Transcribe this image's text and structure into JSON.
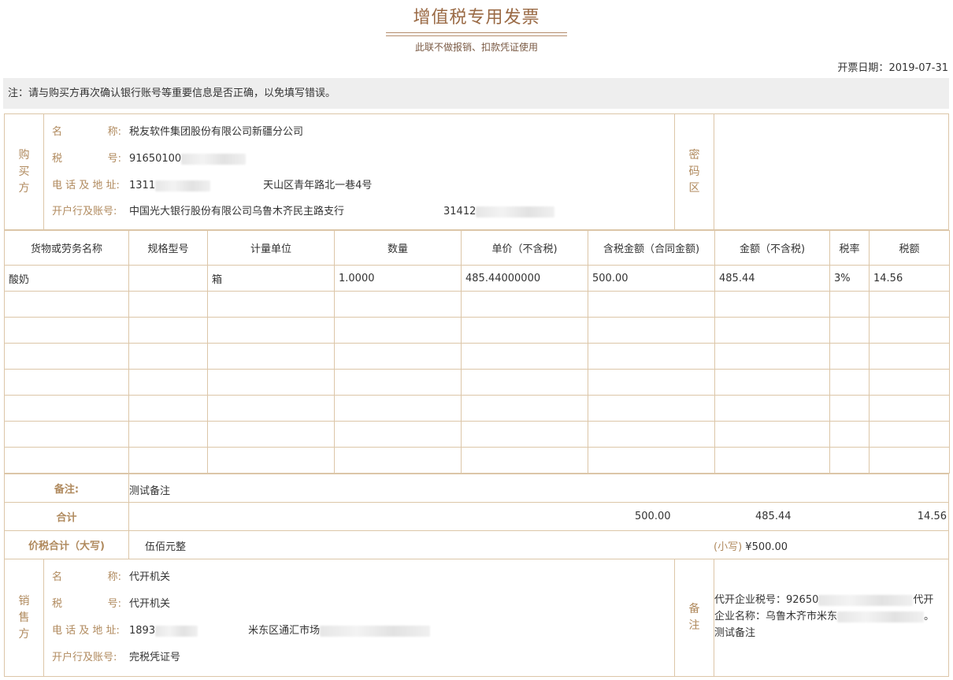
{
  "header": {
    "title": "增值税专用发票",
    "subtitle": "此联不做报销、扣款凭证使用",
    "date_label": "开票日期：",
    "date_value": "2019-07-31"
  },
  "notice": "注：请与购买方再次确认银行账号等重要信息是否正确，以免填写错误。",
  "buyer": {
    "side": "购买方",
    "name_label_a": "名",
    "name_label_b": "称:",
    "name": "税友软件集团股份有限公司新疆分公司",
    "tax_label_a": "税",
    "tax_label_b": "号:",
    "tax_id": "91650100",
    "contact_label": "电 话 及 地 址:",
    "phone": "1311",
    "address": "天山区青年路北一巷4号",
    "bank_label": "开户行及账号:",
    "bank": "中国光大银行股份有限公司乌鲁木齐民主路支行",
    "account": "31412"
  },
  "cipher": {
    "side": "密码区"
  },
  "items_table": {
    "headers": [
      "货物或劳务名称",
      "规格型号",
      "计量单位",
      "数量",
      "单价（不含税)",
      "含税金额（合同金额)",
      "金额（不含税)",
      "税率",
      "税额"
    ],
    "rows": [
      [
        "酸奶",
        "",
        "箱",
        "1.0000",
        "485.44000000",
        "500.00",
        "485.44",
        "3%",
        "14.56"
      ],
      [
        "",
        "",
        "",
        "",
        "",
        "",
        "",
        "",
        ""
      ],
      [
        "",
        "",
        "",
        "",
        "",
        "",
        "",
        "",
        ""
      ],
      [
        "",
        "",
        "",
        "",
        "",
        "",
        "",
        "",
        ""
      ],
      [
        "",
        "",
        "",
        "",
        "",
        "",
        "",
        "",
        ""
      ],
      [
        "",
        "",
        "",
        "",
        "",
        "",
        "",
        "",
        ""
      ],
      [
        "",
        "",
        "",
        "",
        "",
        "",
        "",
        "",
        ""
      ],
      [
        "",
        "",
        "",
        "",
        "",
        "",
        "",
        "",
        ""
      ]
    ]
  },
  "remarks": {
    "label": "备注:",
    "value": "测试备注"
  },
  "totals": {
    "label": "合计",
    "amount_with_tax": "500.00",
    "amount": "485.44",
    "tax": "14.56"
  },
  "grand_total": {
    "label": "价税合计（大写)",
    "words": "伍佰元整",
    "small_label": "(小写)",
    "small_value": "¥500.00"
  },
  "seller": {
    "side": "销售方",
    "name_label_a": "名",
    "name_label_b": "称:",
    "name": "代开机关",
    "tax_label_a": "税",
    "tax_label_b": "号:",
    "tax_id": "代开机关",
    "contact_label": "电 话 及 地 址:",
    "phone": "1893",
    "address": "米东区通汇市场",
    "bank_label": "开户行及账号:",
    "bank": "完税凭证号",
    "remark_side": "备注",
    "remark_line1": "代开企业税号：92650",
    "remark_line1_tail": "代开",
    "remark_line2": "企业名称：乌鲁木齐市米东",
    "remark_line2_tail": "。",
    "remark_line3": "测试备注"
  }
}
